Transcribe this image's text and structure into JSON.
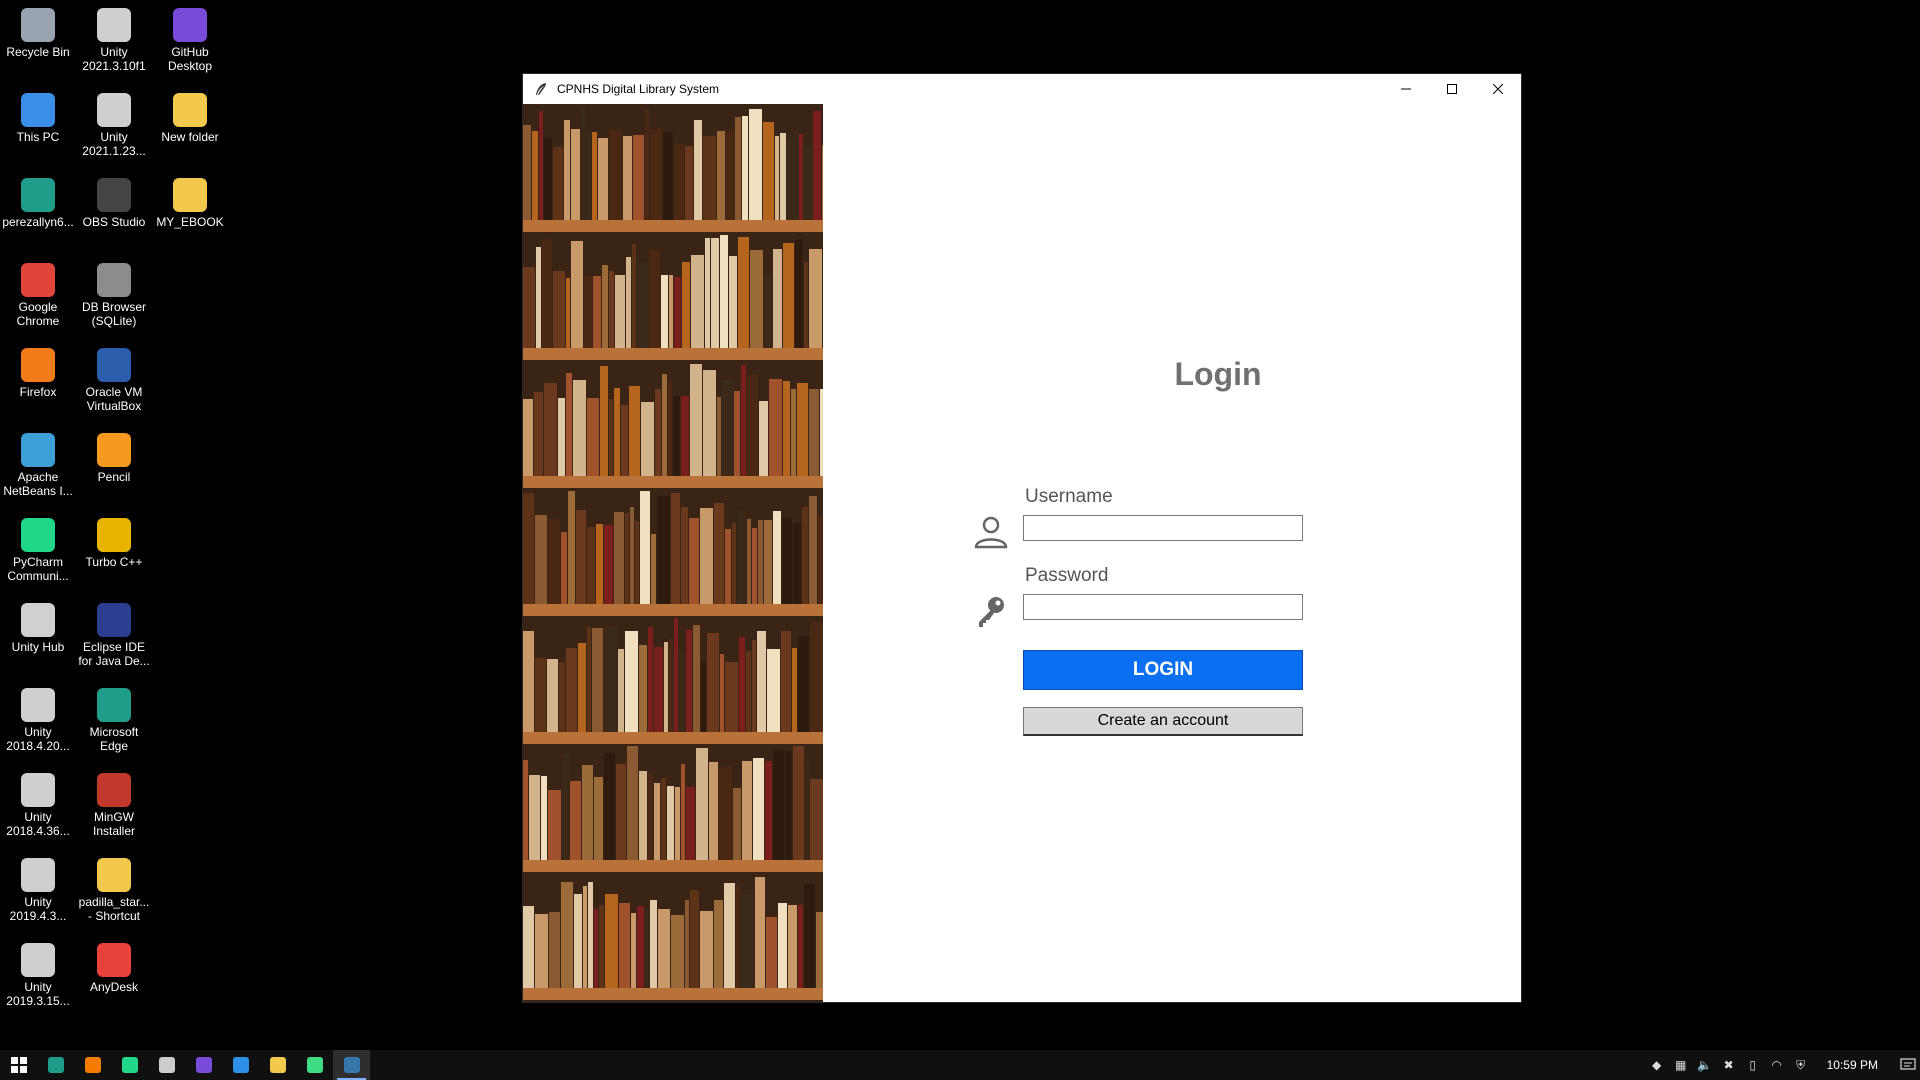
{
  "desktop": {
    "icons": [
      {
        "label": "Recycle Bin",
        "icon": "recycle-bin-icon",
        "color": "#9aa4b0"
      },
      {
        "label": "This PC",
        "icon": "computer-icon",
        "color": "#3a8ee6"
      },
      {
        "label": "perezallyn6...",
        "icon": "edge-profile-icon",
        "color": "#1f9d8a"
      },
      {
        "label": "Google Chrome",
        "icon": "chrome-icon",
        "color": "#e0453a"
      },
      {
        "label": "Firefox",
        "icon": "firefox-icon",
        "color": "#f27b1a"
      },
      {
        "label": "Apache NetBeans I...",
        "icon": "netbeans-icon",
        "color": "#3fa0d8"
      },
      {
        "label": "PyCharm Communi...",
        "icon": "pycharm-icon",
        "color": "#21d789"
      },
      {
        "label": "Unity Hub",
        "icon": "unity-hub-icon",
        "color": "#d0d0d0"
      },
      {
        "label": "Unity 2018.4.20...",
        "icon": "unity-icon",
        "color": "#cfcfcf"
      },
      {
        "label": "Unity 2018.4.36...",
        "icon": "unity-icon",
        "color": "#cfcfcf"
      },
      {
        "label": "Unity 2019.4.3...",
        "icon": "unity-icon",
        "color": "#cfcfcf"
      },
      {
        "label": "Unity 2019.3.15...",
        "icon": "unity-icon",
        "color": "#cfcfcf"
      },
      {
        "label": "Unity 2021.3.10f1",
        "icon": "unity-icon",
        "color": "#cfcfcf"
      },
      {
        "label": "Unity 2021.1.23...",
        "icon": "unity-icon",
        "color": "#cfcfcf"
      },
      {
        "label": "OBS Studio",
        "icon": "obs-icon",
        "color": "#444"
      },
      {
        "label": "DB Browser (SQLite)",
        "icon": "db-browser-icon",
        "color": "#8c8c8c"
      },
      {
        "label": "Oracle VM VirtualBox",
        "icon": "virtualbox-icon",
        "color": "#2a5dab"
      },
      {
        "label": "Pencil",
        "icon": "pencil-icon",
        "color": "#f59a1e"
      },
      {
        "label": "Turbo C++",
        "icon": "turbo-cpp-icon",
        "color": "#e8b400"
      },
      {
        "label": "Eclipse IDE for Java De...",
        "icon": "eclipse-icon",
        "color": "#2c3e8f"
      },
      {
        "label": "Microsoft Edge",
        "icon": "edge-icon",
        "color": "#1f9d8a"
      },
      {
        "label": "MinGW Installer",
        "icon": "mingw-icon",
        "color": "#c0392b"
      },
      {
        "label": "padilla_star... - Shortcut",
        "icon": "folder-shortcut-icon",
        "color": "#f2c94c"
      },
      {
        "label": "AnyDesk",
        "icon": "anydesk-icon",
        "color": "#e8423b"
      },
      {
        "label": "GitHub Desktop",
        "icon": "github-desktop-icon",
        "color": "#7a4ad8"
      },
      {
        "label": "New folder",
        "icon": "folder-icon",
        "color": "#f2c94c"
      },
      {
        "label": "MY_EBOOK",
        "icon": "folder-icon",
        "color": "#f2c94c"
      }
    ]
  },
  "window": {
    "title": "CPNHS Digital Library System",
    "app_icon": "feather-icon"
  },
  "login": {
    "heading": "Login",
    "username_label": "Username",
    "username_value": "",
    "password_label": "Password",
    "password_value": "",
    "login_button": "LOGIN",
    "create_account_button": "Create an account",
    "accent_color": "#0a6ff0"
  },
  "taskbar": {
    "items": [
      {
        "icon": "start-icon",
        "color": "#ffffff"
      },
      {
        "icon": "edge-icon",
        "color": "#1f9d8a"
      },
      {
        "icon": "xampp-icon",
        "color": "#f57c00"
      },
      {
        "icon": "pycharm-icon",
        "color": "#21d789"
      },
      {
        "icon": "terminal-icon",
        "color": "#cccccc"
      },
      {
        "icon": "github-desktop-icon",
        "color": "#7a4ad8"
      },
      {
        "icon": "vscode-icon",
        "color": "#2d8fe6"
      },
      {
        "icon": "file-explorer-icon",
        "color": "#f2c94c"
      },
      {
        "icon": "android-studio-icon",
        "color": "#3ddc84"
      },
      {
        "icon": "python-app-icon",
        "color": "#3776ab",
        "active": true
      }
    ],
    "clock": "10:59 PM",
    "tray_icons": [
      "anydesk-tray-icon",
      "network-monitor-icon",
      "volume-icon",
      "xampp-tray-icon",
      "battery-icon",
      "wifi-icon",
      "security-icon"
    ],
    "notification_icon": "notification-icon"
  }
}
